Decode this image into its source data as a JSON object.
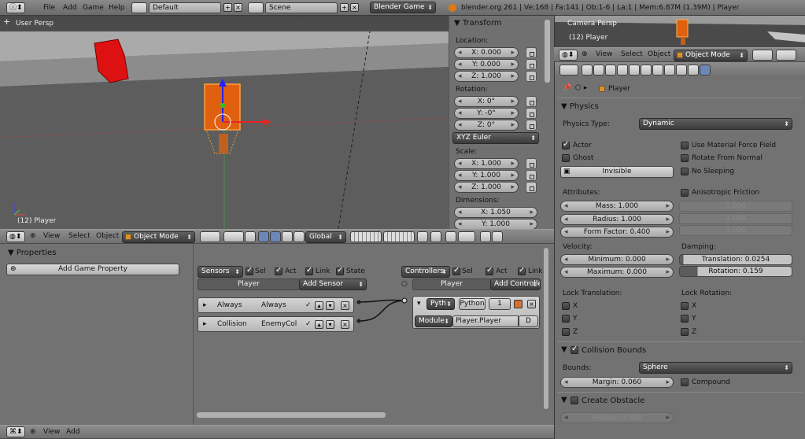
{
  "topbar": {
    "menus": [
      "File",
      "Add",
      "Game",
      "Help"
    ],
    "layout": "Default",
    "scene": "Scene",
    "engine": "Blender Game",
    "info": "blender.org 261 | Ve:168 | Fa:141 | Ob:1-6 | La:1 | Mem:6.87M (1.39M) | Player"
  },
  "viewport": {
    "view_label": "User Persp",
    "object_label": "(12) Player"
  },
  "transform": {
    "title": "Transform",
    "location_label": "Location:",
    "location": [
      "X: 0.000",
      "Y: 0.000",
      "Z: 1.000"
    ],
    "rotation_label": "Rotation:",
    "rotation": [
      "X: 0°",
      "Y: -0°",
      "Z: 0°"
    ],
    "rot_mode": "XYZ Euler",
    "scale_label": "Scale:",
    "scale": [
      "X: 1.000",
      "Y: 1.000",
      "Z: 1.000"
    ],
    "dimensions_label": "Dimensions:",
    "dimensions": [
      "X: 1.050",
      "Y: 1.000"
    ]
  },
  "view_header": {
    "menus": [
      "View",
      "Select",
      "Object"
    ],
    "mode": "Object Mode",
    "orientation": "Global"
  },
  "props_panel": {
    "title": "Properties",
    "add_prop": "Add Game Property"
  },
  "logic": {
    "sensors_label": "Sensors",
    "sel": "Sel",
    "act": "Act",
    "link": "Link",
    "state": "State",
    "player": "Player",
    "add_sensor": "Add Sensor",
    "controllers_label": "Controllers",
    "add_controller": "Add Controller",
    "sensor1": {
      "type": "Always",
      "name": "Always"
    },
    "sensor2": {
      "type": "Collision",
      "name": "EnemyCol"
    },
    "ctrl": {
      "type": "Pyth",
      "lang": "Python",
      "num": "1",
      "module": "Module",
      "script": "Player.Player",
      "d": "D"
    }
  },
  "bottom_header": {
    "menus": [
      "View",
      "Add"
    ]
  },
  "camera": {
    "label": "Camera Persp",
    "object_label": "(12) Player",
    "menus": [
      "View",
      "Select",
      "Object"
    ],
    "mode": "Object Mode"
  },
  "physics": {
    "breadcrumb": "Player",
    "title": "Physics",
    "type_label": "Physics Type:",
    "type": "Dynamic",
    "actor": "Actor",
    "ghost": "Ghost",
    "invisible": "Invisible",
    "use_force_field": "Use Material Force Field",
    "rotate_normal": "Rotate From Normal",
    "no_sleeping": "No Sleeping",
    "attributes": "Attributes:",
    "mass": "Mass: 1.000",
    "radius": "Radius: 1.000",
    "form_factor": "Form Factor: 0.400",
    "aniso": "Anisotropic Friction",
    "aniso_vals": [
      "1.000",
      "1.000",
      "1.000"
    ],
    "velocity": "Velocity:",
    "minimum": "Minimum: 0.000",
    "maximum": "Maximum: 0.000",
    "damping": "Damping:",
    "translation": "Translation: 0.0254",
    "rotation": "Rotation: 0.159",
    "lock_t": "Lock Translation:",
    "lock_r": "Lock Rotation:",
    "x": "X",
    "y": "Y",
    "z": "Z",
    "collision_bounds": "Collision Bounds",
    "bounds_label": "Bounds:",
    "bounds": "Sphere",
    "margin": "Margin: 0.060",
    "compound": "Compound",
    "create_obstacle": "Create Obstacle",
    "obs_radius": "Radius: 0.000"
  }
}
